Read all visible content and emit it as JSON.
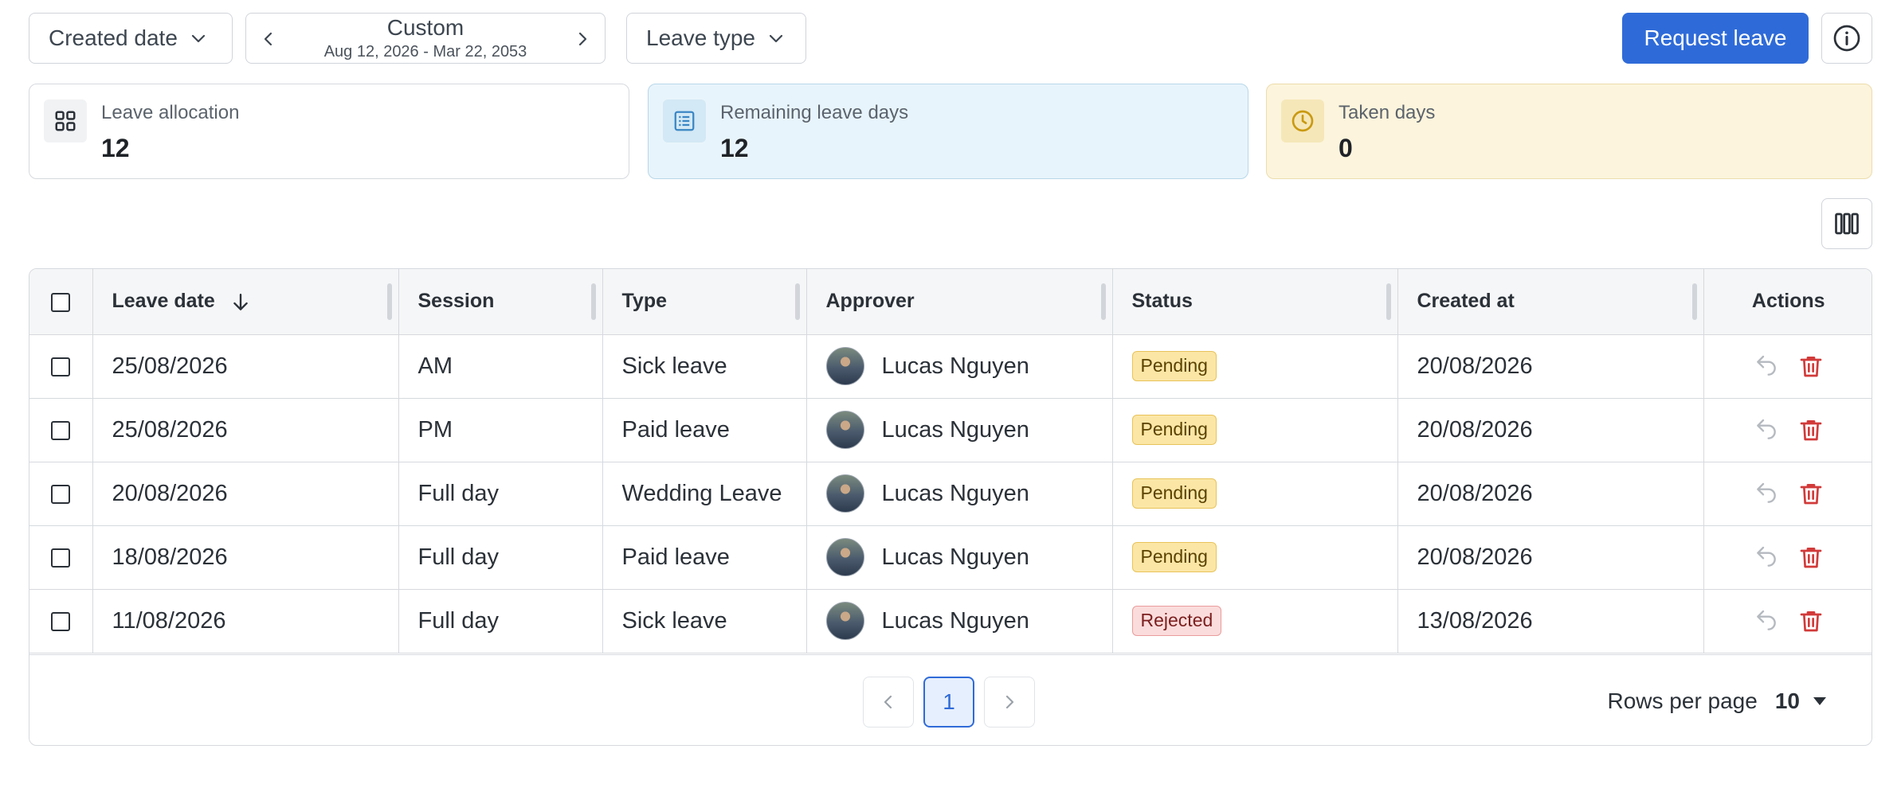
{
  "toolbar": {
    "created_date_label": "Created date",
    "range_title": "Custom",
    "range_dates": "Aug 12, 2026 - Mar 22, 2053",
    "leave_type_label": "Leave type",
    "request_leave_label": "Request leave"
  },
  "cards": [
    {
      "label": "Leave allocation",
      "value": "12",
      "icon": "grid-icon"
    },
    {
      "label": "Remaining leave days",
      "value": "12",
      "icon": "list-icon",
      "accent": "#e8f4fb"
    },
    {
      "label": "Taken days",
      "value": "0",
      "icon": "clock-icon",
      "accent": "#fcf4dc"
    }
  ],
  "table": {
    "columns": [
      "Leave date",
      "Session",
      "Type",
      "Approver",
      "Status",
      "Created at",
      "Actions"
    ],
    "sort_column": "Leave date",
    "sort_direction": "descending",
    "rows": [
      {
        "leave_date": "25/08/2026",
        "session": "AM",
        "type": "Sick leave",
        "approver": "Lucas Nguyen",
        "status": "Pending",
        "created_at": "20/08/2026"
      },
      {
        "leave_date": "25/08/2026",
        "session": "PM",
        "type": "Paid leave",
        "approver": "Lucas Nguyen",
        "status": "Pending",
        "created_at": "20/08/2026"
      },
      {
        "leave_date": "20/08/2026",
        "session": "Full day",
        "type": "Wedding Leave",
        "approver": "Lucas Nguyen",
        "status": "Pending",
        "created_at": "20/08/2026"
      },
      {
        "leave_date": "18/08/2026",
        "session": "Full day",
        "type": "Paid leave",
        "approver": "Lucas Nguyen",
        "status": "Pending",
        "created_at": "20/08/2026"
      },
      {
        "leave_date": "11/08/2026",
        "session": "Full day",
        "type": "Sick leave",
        "approver": "Lucas Nguyen",
        "status": "Rejected",
        "created_at": "13/08/2026"
      }
    ]
  },
  "pagination": {
    "current_page": "1",
    "rows_per_page_label": "Rows per page",
    "rows_per_page_value": "10"
  },
  "colors": {
    "primary": "#2f6bd8",
    "pending_bg": "#fbe6a6",
    "rejected_bg": "#fbdcdc",
    "delete_icon": "#d23a3a"
  }
}
